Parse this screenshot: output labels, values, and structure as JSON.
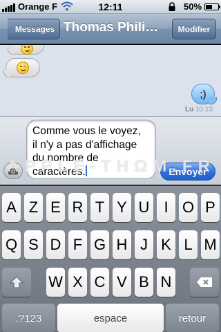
{
  "status_bar": {
    "carrier": "Orange F",
    "time": "12:11",
    "battery_percent": "50%",
    "battery_level": 0.5
  },
  "nav": {
    "back_label": "Messages",
    "title": "Thomas Phili…",
    "edit_label": "Modifier"
  },
  "conversation": {
    "outgoing_message": ";)",
    "timestamp_sender": "Lu",
    "timestamp_time": "10:13"
  },
  "compose": {
    "text_lines": [
      "Comme vous le voyez,",
      "il n'y a pas d'affichage",
      "du nombre de",
      "caractères."
    ],
    "send_label": "Envoyer",
    "watermark": "APPLE-THΩM.FR"
  },
  "keyboard": {
    "row1": [
      "A",
      "Z",
      "E",
      "R",
      "T",
      "Y",
      "U",
      "I",
      "O",
      "P"
    ],
    "row2": [
      "Q",
      "S",
      "D",
      "F",
      "G",
      "H",
      "J",
      "K",
      "L",
      "M"
    ],
    "row3": [
      "W",
      "X",
      "C",
      "V",
      "B",
      "N"
    ],
    "numbers_label": ".?123",
    "space_label": "espace",
    "return_label": "retour"
  },
  "colors": {
    "accent": "#2e6fd9",
    "navbar": "#6d87a7",
    "conversation_bg": "#dbe2ed",
    "outgoing_bubble": "#6fb4f0"
  },
  "icons": [
    "signal-icon",
    "wifi-icon",
    "lock-icon",
    "battery-icon",
    "camera-icon",
    "shift-icon",
    "backspace-icon",
    "smiley-emoji-icon",
    "wink-emoji-icon"
  ]
}
